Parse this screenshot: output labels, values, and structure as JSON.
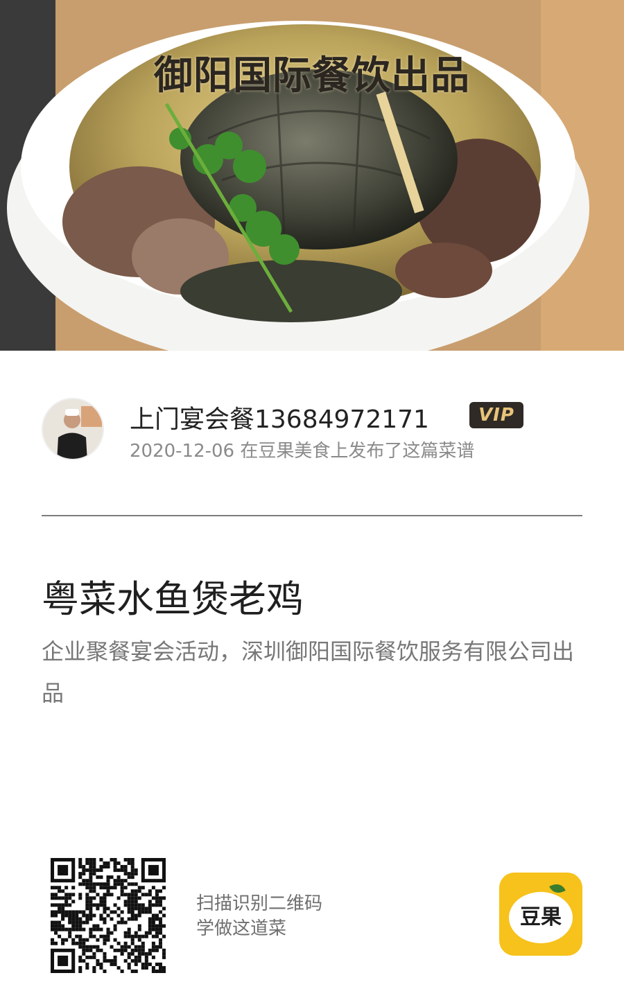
{
  "hero": {
    "watermark": "御阳国际餐饮出品"
  },
  "author": {
    "name": "上门宴会餐13684972171",
    "badge": "VIP",
    "publish_date": "2020-12-06",
    "publish_text": "在豆果美食上发布了这篇菜谱"
  },
  "recipe": {
    "title": "粤菜水鱼煲老鸡",
    "description": "企业聚餐宴会活动，深圳御阳国际餐饮服务有限公司出品"
  },
  "footer": {
    "scan_line1": "扫描识别二维码",
    "scan_line2": "学做这道菜",
    "app_name": "豆果"
  },
  "colors": {
    "vip_bg": "#2f2a25",
    "vip_text": "#e8c37a",
    "app_yellow": "#f6c21b"
  }
}
